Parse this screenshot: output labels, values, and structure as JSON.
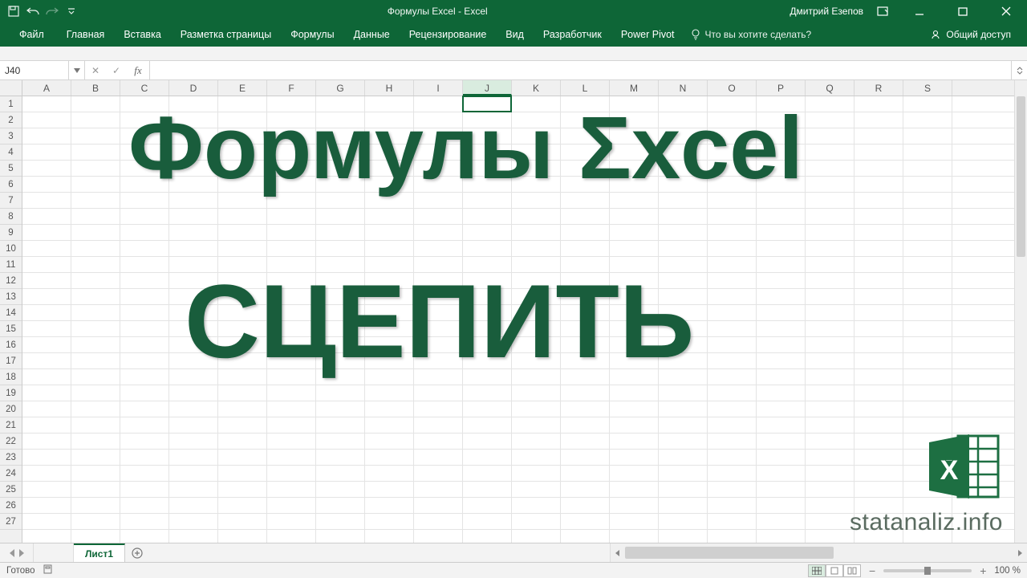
{
  "titlebar": {
    "title": "Формулы Excel  -  Excel",
    "user": "Дмитрий Езепов"
  },
  "ribbon": {
    "tabs": [
      "Файл",
      "Главная",
      "Вставка",
      "Разметка страницы",
      "Формулы",
      "Данные",
      "Рецензирование",
      "Вид",
      "Разработчик",
      "Power Pivot"
    ],
    "tell_me": "Что вы хотите сделать?",
    "share": "Общий доступ"
  },
  "formula_bar": {
    "name_box": "J40",
    "formula": ""
  },
  "grid": {
    "columns": [
      "A",
      "B",
      "C",
      "D",
      "E",
      "F",
      "G",
      "H",
      "I",
      "J",
      "K",
      "L",
      "M",
      "N",
      "O",
      "P",
      "Q",
      "R",
      "S"
    ],
    "selected_col": "J",
    "row_count": 27,
    "selected_row": 40
  },
  "overlay": {
    "line1": "Формулы Σxcel",
    "line2": "СЦЕПИТЬ",
    "url": "statanaliz.info"
  },
  "sheet_tabs": {
    "active": "Лист1"
  },
  "statusbar": {
    "state": "Готово",
    "zoom": "100 %"
  }
}
